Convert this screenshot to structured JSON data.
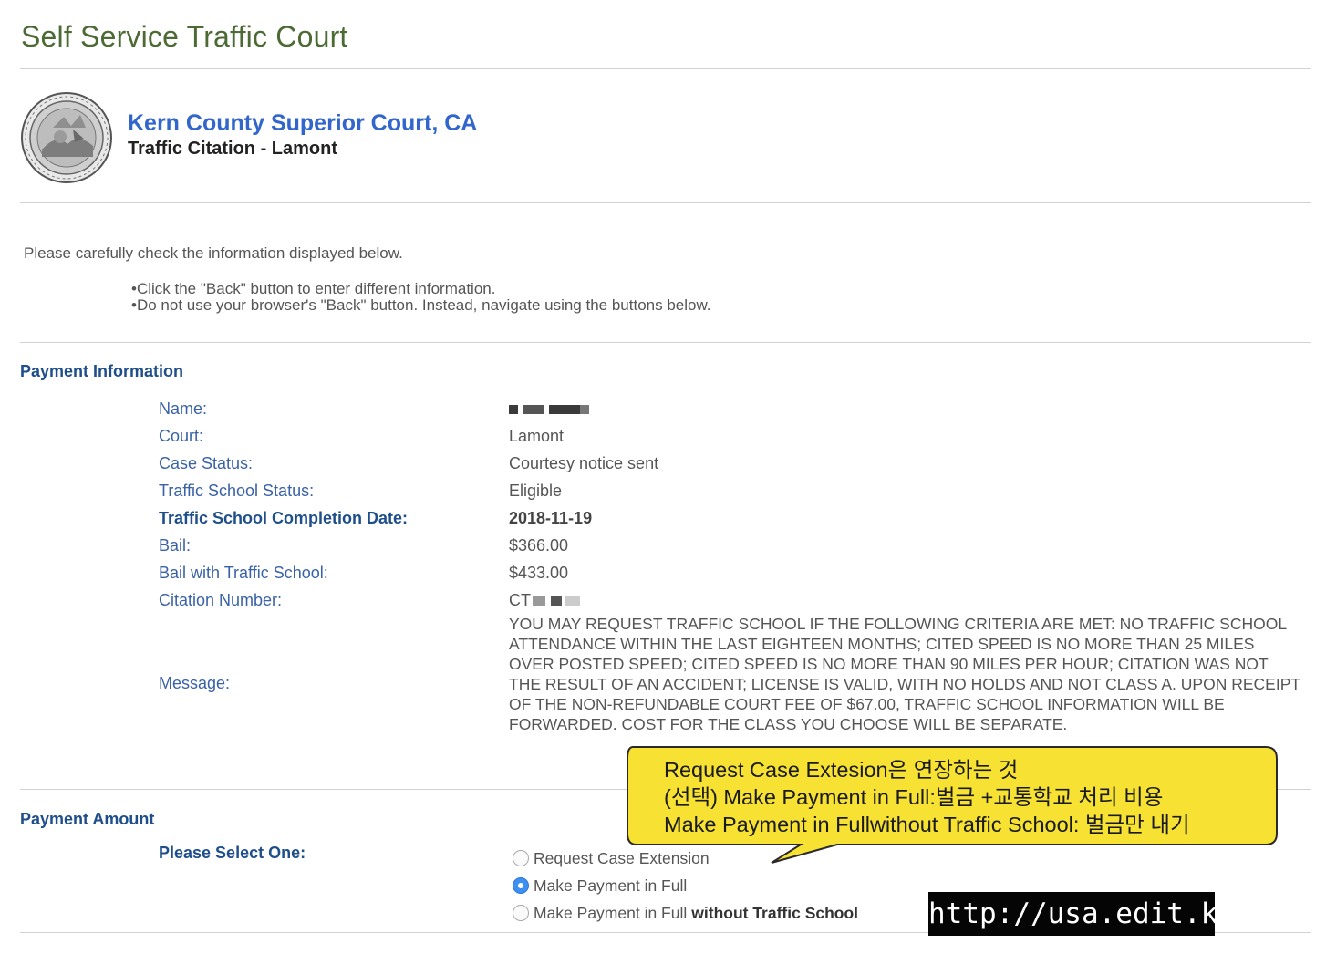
{
  "app_title": "Self Service Traffic Court",
  "header": {
    "court_name": "Kern County Superior Court, CA",
    "subtitle": "Traffic Citation - Lamont"
  },
  "intro": "Please carefully check the information displayed below.",
  "notes": [
    "Click the \"Back\" button to enter different information.",
    "Do not use your browser's \"Back\" button. Instead, navigate using the buttons below."
  ],
  "payment_info": {
    "heading": "Payment Information",
    "fields": {
      "name": {
        "label": "Name:",
        "value": ""
      },
      "court": {
        "label": "Court:",
        "value": "Lamont"
      },
      "case_status": {
        "label": "Case Status:",
        "value": "Courtesy notice sent"
      },
      "ts_status": {
        "label": "Traffic School Status:",
        "value": "Eligible"
      },
      "ts_date": {
        "label": "Traffic School Completion Date:",
        "value": "2018-11-19"
      },
      "bail": {
        "label": "Bail:",
        "value": "$366.00"
      },
      "bail_ts": {
        "label": "Bail with Traffic School:",
        "value": "$433.00"
      },
      "citation": {
        "label": "Citation Number:",
        "value": "CT"
      }
    },
    "message_label": "Message:",
    "message": "YOU MAY REQUEST TRAFFIC SCHOOL IF THE FOLLOWING CRITERIA ARE MET: NO TRAFFIC SCHOOL ATTENDANCE WITHIN THE LAST EIGHTEEN MONTHS; CITED SPEED IS NO MORE THAN 25 MILES OVER POSTED SPEED; CITED SPEED IS NO MORE THAN 90 MILES PER HOUR; CITATION WAS NOT THE RESULT OF AN ACCIDENT; LICENSE IS VALID, WITH NO HOLDS AND NOT CLASS A. UPON RECEIPT OF THE NON-REFUNDABLE COURT FEE OF $67.00, TRAFFIC SCHOOL INFORMATION WILL BE FORWARDED. COST FOR THE CLASS YOU CHOOSE WILL BE SEPARATE."
  },
  "payment_amount": {
    "heading": "Payment Amount",
    "select_label": "Please Select One:",
    "options": [
      {
        "label": "Request Case Extension",
        "selected": false
      },
      {
        "label": "Make Payment in Full",
        "selected": true
      },
      {
        "label": "Make Payment in Full",
        "bold_suffix": "without Traffic School",
        "selected": false
      }
    ]
  },
  "callout": {
    "lines": [
      "Request Case Extesion은 연장하는 것",
      "(선택) Make Payment in Full:벌금 +교통학교 처리 비용",
      "Make Payment in Fullwithout Traffic School:  벌금만 내기"
    ],
    "fill": "#f7e234",
    "stroke": "#2a2a2a"
  },
  "watermark": "http://usa.edit.kr",
  "colors": {
    "title_green": "#4b6a34",
    "court_blue": "#3366cc",
    "label_blue": "#3a62a6",
    "heading_navy": "#1f4f8a",
    "radio_selected": "#3d8ff0"
  }
}
